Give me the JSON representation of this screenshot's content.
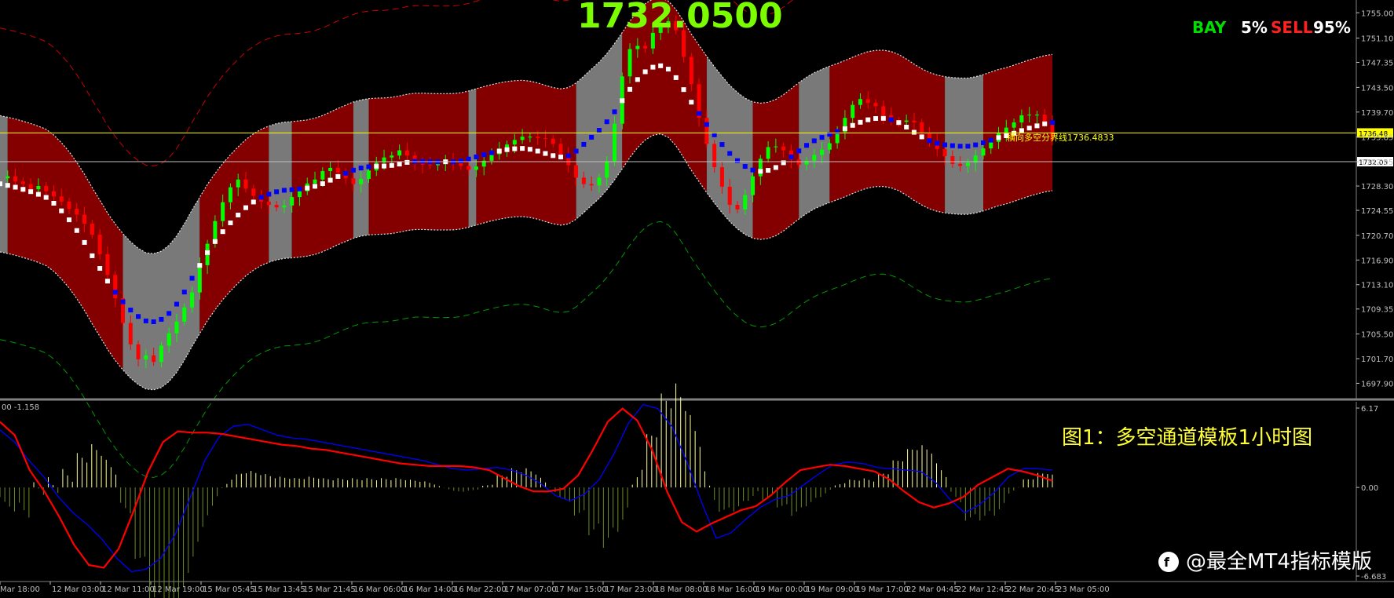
{
  "chart_data": {
    "type": "line",
    "symbol_header": "",
    "current_price_big": "1732.0500",
    "buy_sell": {
      "buy_label": "BAY",
      "buy_pct": "5%",
      "sell_label": "SELL",
      "sell_pct": "95%",
      "buy_color": "#00e000",
      "sell_color": "#ff2020"
    },
    "y_axis_ticks": [
      "1755.00",
      "1751.10",
      "1747.35",
      "1743.50",
      "1739.70",
      "1735.85",
      "1732.05",
      "1728.30",
      "1724.55",
      "1720.70",
      "1716.90",
      "1713.10",
      "1709.35",
      "1705.50",
      "1701.70",
      "1697.90"
    ],
    "ylim": [
      1696.5,
      1756.0
    ],
    "price_markers": [
      {
        "value": 1736.48,
        "label": "1736.48",
        "color": "#ffff00",
        "note": "横向多空分界线1736.4833"
      },
      {
        "value": 1732.05,
        "label": "1732.05",
        "color": "#c0c0c0"
      }
    ],
    "x_axis_ticks": [
      "Mar 18:00",
      "12 Mar 03:00",
      "12 Mar 11:00",
      "12 Mar 19:00",
      "15 Mar 05:45",
      "15 Mar 13:45",
      "15 Mar 21:45",
      "16 Mar 06:00",
      "16 Mar 14:00",
      "16 Mar 22:00",
      "17 Mar 07:00",
      "17 Mar 15:00",
      "17 Mar 23:00",
      "18 Mar 08:00",
      "18 Mar 16:00",
      "19 Mar 00:00",
      "19 Mar 09:00",
      "19 Mar 17:00",
      "22 Mar 04:45",
      "22 Mar 12:45",
      "22 Mar 20:45",
      "23 Mar 05:00"
    ],
    "close_series": [
      1729.5,
      1729.8,
      1729.0,
      1728.6,
      1727.8,
      1728.3,
      1727.5,
      1726.7,
      1725.9,
      1724.8,
      1723.9,
      1722.5,
      1720.8,
      1717.8,
      1714.6,
      1711.0,
      1707.2,
      1703.9,
      1701.6,
      1702.2,
      1701.2,
      1703.7,
      1705.6,
      1707.4,
      1709.6,
      1711.9,
      1716.1,
      1719.4,
      1722.9,
      1725.8,
      1728.1,
      1729.3,
      1727.9,
      1726.8,
      1725.9,
      1725.4,
      1725.0,
      1725.3,
      1726.6,
      1727.5,
      1728.7,
      1729.3,
      1730.6,
      1731.1,
      1730.4,
      1729.5,
      1728.6,
      1729.4,
      1730.7,
      1731.9,
      1732.7,
      1733.0,
      1733.8,
      1733.0,
      1731.8,
      1731.6,
      1731.5,
      1731.7,
      1732.2,
      1732.0,
      1731.4,
      1730.8,
      1731.3,
      1732.2,
      1733.2,
      1733.9,
      1734.7,
      1735.4,
      1735.9,
      1735.9,
      1735.7,
      1735.6,
      1734.8,
      1733.1,
      1731.5,
      1729.6,
      1728.6,
      1728.4,
      1729.6,
      1732.0,
      1737.9,
      1745.2,
      1749.4,
      1749.9,
      1749.5,
      1751.9,
      1753.2,
      1753.7,
      1752.3,
      1748.2,
      1744.0,
      1738.8,
      1734.8,
      1731.2,
      1728.2,
      1725.4,
      1724.7,
      1726.9,
      1729.8,
      1732.5,
      1734.3,
      1734.4,
      1733.8,
      1732.4,
      1731.6,
      1732.2,
      1733.1,
      1733.9,
      1734.9,
      1736.6,
      1738.8,
      1740.8,
      1741.7,
      1741.1,
      1740.6,
      1739.2,
      1738.3,
      1738.2,
      1738.4,
      1738.1,
      1736.5,
      1735.2,
      1734.0,
      1732.9,
      1731.7,
      1731.4,
      1731.9,
      1733.0,
      1734.1,
      1735.1,
      1736.5,
      1737.3,
      1738.1,
      1739.2,
      1739.3,
      1739.3,
      1738.0,
      1735.4
    ],
    "up_color": "#00ff00",
    "down_color": "#ff0000",
    "bull_channel_color": "#8b0000",
    "bear_channel_color": "#808080",
    "macd": {
      "ylim": [
        -6.683,
        6.17
      ],
      "y_ticks": [
        "6.17",
        "0.00",
        "-6.683"
      ],
      "header": "00 -1.158",
      "signal_color": "#ff0000",
      "macd_color": "#0000ff",
      "hist_pos_color": "#ffff99",
      "hist_neg_color": "#6b8e23",
      "macd_series": [
        4.3,
        3.4,
        2.0,
        0.8,
        -0.7,
        -1.9,
        -2.8,
        -3.9,
        -5.3,
        -6.3,
        -6.1,
        -5.3,
        -3.5,
        -0.8,
        2.0,
        3.8,
        4.6,
        4.7,
        4.3,
        3.9,
        3.7,
        3.6,
        3.4,
        3.2,
        3.0,
        2.8,
        2.6,
        2.4,
        2.2,
        2.0,
        1.7,
        1.4,
        1.3,
        1.4,
        1.5,
        1.3,
        0.9,
        0.3,
        -0.6,
        -1.0,
        -0.5,
        0.6,
        2.5,
        4.8,
        6.2,
        5.9,
        4.5,
        1.9,
        -1.1,
        -3.8,
        -3.4,
        -2.4,
        -1.5,
        -0.9,
        -0.6,
        0.2,
        1.0,
        1.7,
        1.9,
        1.8,
        1.5,
        1.4,
        1.3,
        1.2,
        0.4,
        -0.9,
        -1.9,
        -1.3,
        -0.4,
        0.8,
        1.4,
        1.4,
        1.3
      ],
      "signal_series": [
        4.9,
        3.9,
        1.3,
        -0.3,
        -2.2,
        -4.3,
        -5.8,
        -6.0,
        -4.6,
        -1.8,
        1.2,
        3.4,
        4.2,
        4.1,
        4.1,
        4.0,
        3.8,
        3.6,
        3.4,
        3.2,
        3.1,
        2.9,
        2.8,
        2.6,
        2.4,
        2.2,
        2.0,
        1.8,
        1.7,
        1.6,
        1.6,
        1.6,
        1.5,
        1.3,
        0.7,
        0.1,
        -0.3,
        -0.3,
        -0.1,
        0.9,
        2.8,
        4.9,
        5.9,
        5.0,
        2.8,
        -0.3,
        -2.6,
        -3.3,
        -2.7,
        -2.2,
        -1.7,
        -1.4,
        -0.6,
        0.4,
        1.3,
        1.5,
        1.7,
        1.6,
        1.4,
        1.2,
        0.6,
        -0.3,
        -1.1,
        -1.5,
        -1.2,
        -0.7,
        0.2,
        0.8,
        1.4,
        1.2,
        0.9,
        0.5
      ]
    },
    "caption": "图1：多空通道模板1小时图",
    "watermark": "@最全MT4指标模版"
  }
}
